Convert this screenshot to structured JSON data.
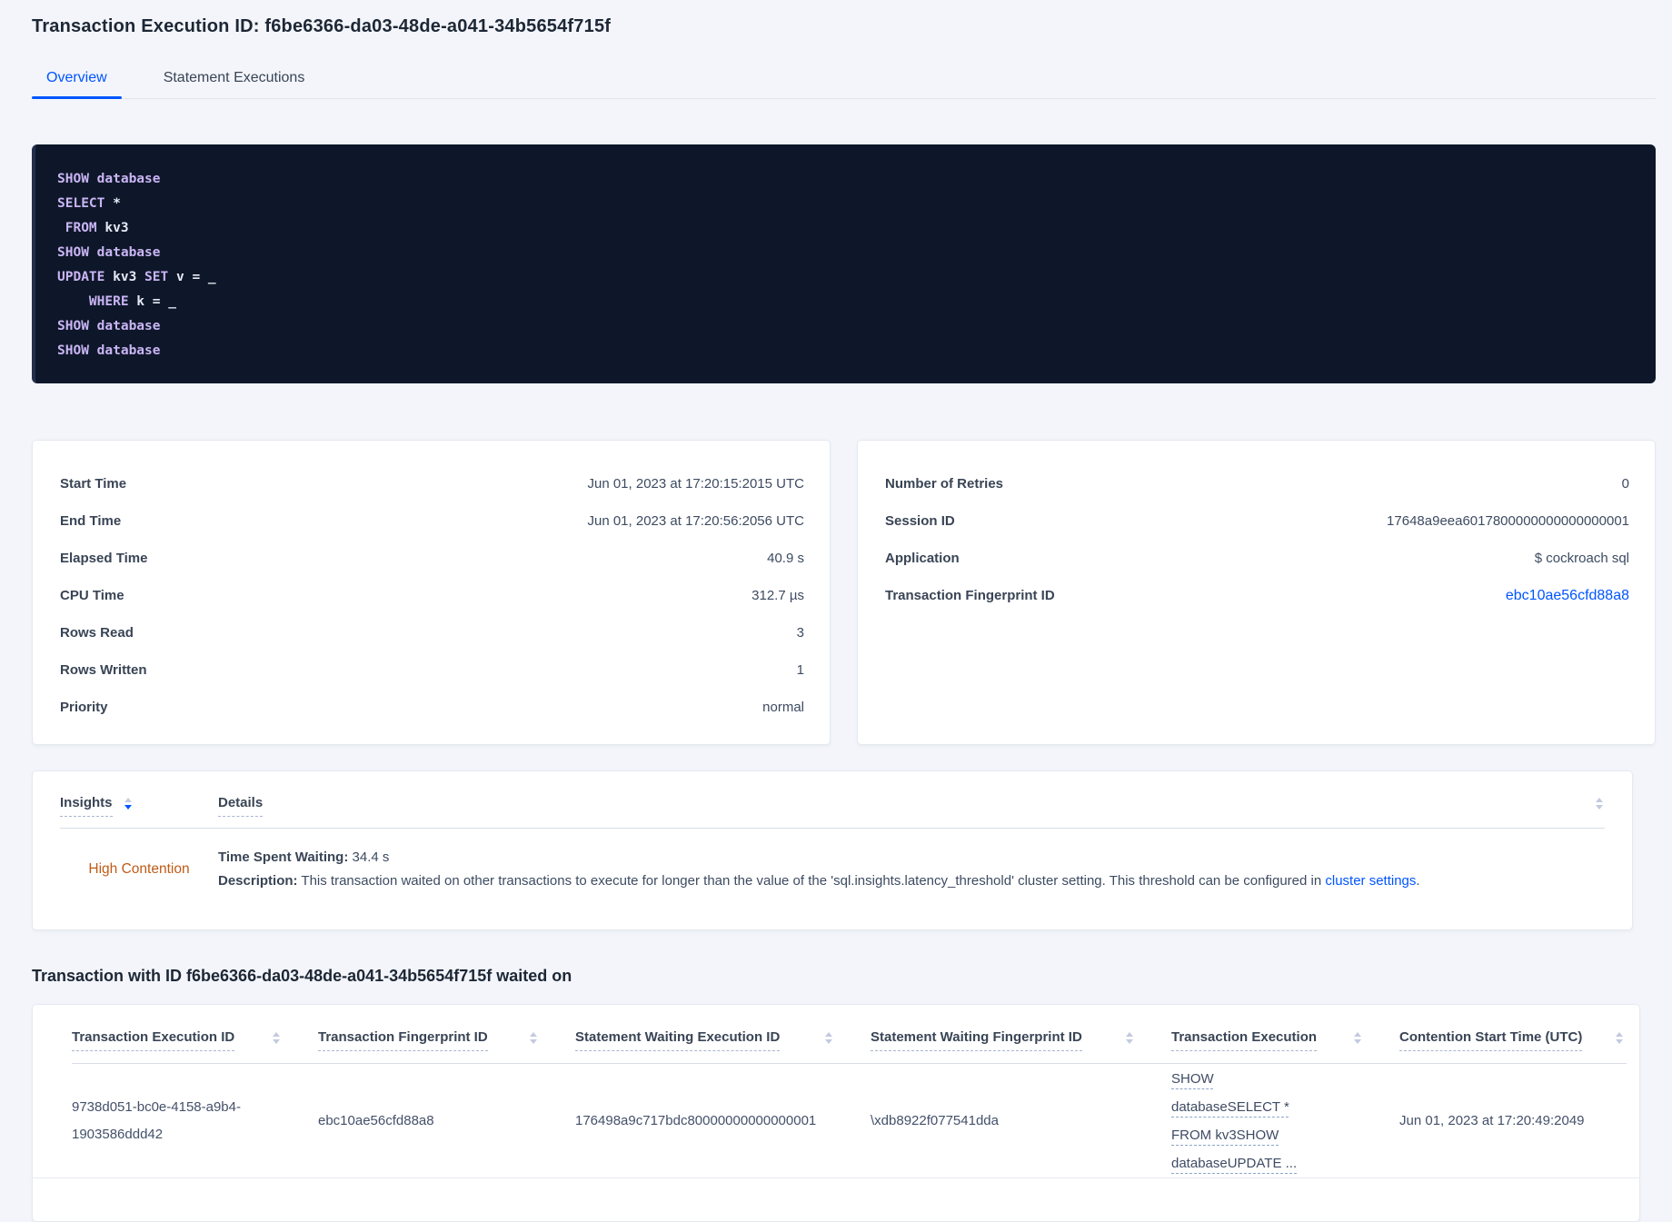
{
  "header": {
    "title": "Transaction Execution ID: f6be6366-da03-48de-a041-34b5654f715f",
    "tabs": [
      {
        "label": "Overview",
        "active": true
      },
      {
        "label": "Statement Executions",
        "active": false
      }
    ]
  },
  "sql_box": {
    "lines": [
      {
        "tokens": [
          {
            "cls": "kw",
            "text": "SHOW database"
          }
        ]
      },
      {
        "tokens": [
          {
            "cls": "kw",
            "text": "SELECT"
          },
          {
            "cls": "pl",
            "text": " *"
          }
        ]
      },
      {
        "tokens": [
          {
            "cls": "pl",
            "text": " "
          },
          {
            "cls": "kw",
            "text": "FROM"
          },
          {
            "cls": "pl",
            "text": " kv3"
          }
        ]
      },
      {
        "tokens": [
          {
            "cls": "kw",
            "text": "SHOW database"
          }
        ]
      },
      {
        "tokens": [
          {
            "cls": "kw",
            "text": "UPDATE"
          },
          {
            "cls": "pl",
            "text": " kv3 "
          },
          {
            "cls": "kw",
            "text": "SET"
          },
          {
            "cls": "pl",
            "text": " v = _"
          }
        ]
      },
      {
        "tokens": [
          {
            "cls": "pl",
            "text": "    "
          },
          {
            "cls": "kw",
            "text": "WHERE"
          },
          {
            "cls": "pl",
            "text": " k = _"
          }
        ]
      },
      {
        "tokens": [
          {
            "cls": "kw",
            "text": "SHOW database"
          }
        ]
      },
      {
        "tokens": [
          {
            "cls": "kw",
            "text": "SHOW database"
          }
        ]
      }
    ]
  },
  "summary_cards": {
    "left": {
      "rows": [
        {
          "label": "Start Time",
          "value": "Jun 01, 2023 at 17:20:15:2015 UTC"
        },
        {
          "label": "End Time",
          "value": "Jun 01, 2023 at 17:20:56:2056 UTC"
        },
        {
          "label": "Elapsed Time",
          "value": "40.9 s"
        },
        {
          "label": "CPU Time",
          "value": "312.7 µs"
        },
        {
          "label": "Rows Read",
          "value": "3"
        },
        {
          "label": "Rows Written",
          "value": "1"
        },
        {
          "label": "Priority",
          "value": "normal"
        }
      ]
    },
    "right": {
      "rows": [
        {
          "label": "Number of Retries",
          "value": "0"
        },
        {
          "label": "Session ID",
          "value": "17648a9eea6017800000000000000001"
        },
        {
          "label": "Application",
          "value": "$ cockroach sql"
        },
        {
          "label": "Transaction Fingerprint ID",
          "value": "ebc10ae56cfd88a8",
          "link": true
        }
      ]
    }
  },
  "insights_table": {
    "columns": [
      {
        "label": "Insights",
        "sorted": "desc"
      },
      {
        "label": "Details"
      }
    ],
    "row": {
      "insight": "High Contention",
      "waiting_label": "Time Spent Waiting:",
      "waiting_value": " 34.4 s",
      "description_label": "Description:",
      "description_text": " This transaction waited on other transactions to execute for longer than the value of the 'sql.insights.latency_threshold' cluster setting. This threshold can be configured in ",
      "description_link": "cluster settings",
      "description_suffix": "."
    }
  },
  "waited_on": {
    "heading": "Transaction with ID f6be6366-da03-48de-a041-34b5654f715f waited on",
    "columns": [
      "Transaction Execution ID",
      "Transaction Fingerprint ID",
      "Statement Waiting Execution ID",
      "Statement Waiting Fingerprint ID",
      "Transaction Execution",
      "Contention Start Time (UTC)"
    ],
    "rows": [
      {
        "transaction_execution_id": "9738d051-bc0e-4158-a9b4-1903586ddd42",
        "transaction_fingerprint_id": "ebc10ae56cfd88a8",
        "statement_waiting_execution_id": "176498a9c717bdc80000000000000001",
        "statement_waiting_fingerprint_id": "\\xdb8922f077541dda",
        "transaction_execution": "SHOW databaseSELECT * FROM kv3SHOW databaseUPDATE ...",
        "contention_start_time": "Jun 01, 2023 at 17:20:49:2049"
      }
    ]
  },
  "colors": {
    "accent_blue": "#0055ff",
    "insight_orange": "#bf5b16",
    "code_background": "#0e1729",
    "code_keyword": "#c9b5f4"
  }
}
